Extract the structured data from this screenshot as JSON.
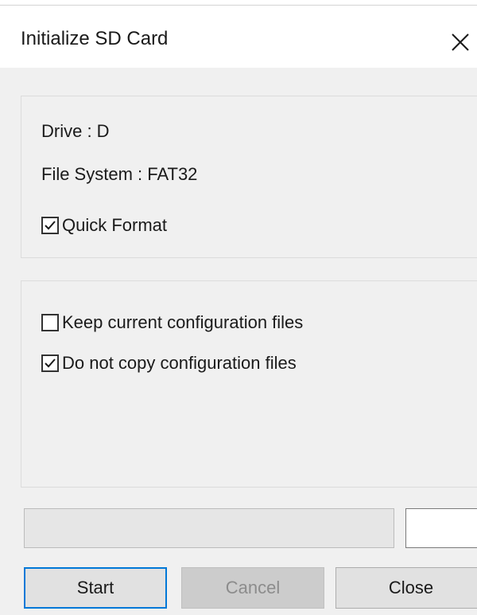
{
  "window": {
    "title": "Initialize SD Card",
    "close_icon": "close-icon"
  },
  "drive_info": {
    "drive_text": "Drive : D",
    "file_system_text": "File System : FAT32",
    "quick_format": {
      "label": "Quick Format",
      "checked": true
    }
  },
  "config_options": {
    "keep_current": {
      "label": "Keep current configuration files",
      "checked": false
    },
    "do_not_copy": {
      "label": "Do not copy configuration files",
      "checked": true
    }
  },
  "progress": {
    "value": 0
  },
  "buttons": {
    "start": "Start",
    "cancel": "Cancel",
    "close": "Close"
  },
  "colors": {
    "accent": "#0078d7",
    "dialog_background": "#f0f0f0",
    "disabled_text": "#8c8c8c"
  }
}
